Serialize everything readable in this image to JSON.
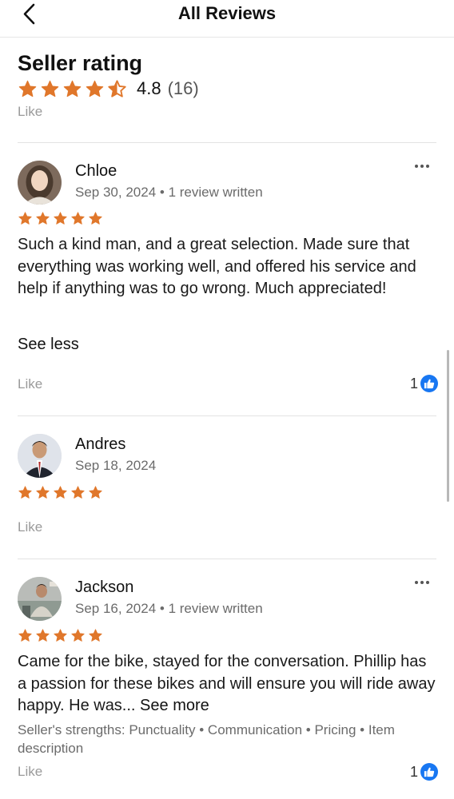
{
  "header": {
    "title": "All Reviews",
    "back_icon": "chevron-left-icon"
  },
  "summary": {
    "title": "Seller rating",
    "rating": 4.8,
    "rating_text": "4.8",
    "count_text": "(16)",
    "stars": 4.5,
    "like_label": "Like"
  },
  "colors": {
    "star": "#e0772b",
    "like_blue": "#1877f2",
    "muted": "#9a9a9a"
  },
  "reviews": [
    {
      "name": "Chloe",
      "date": "Sep 30, 2024",
      "meta_extra": "1 review written",
      "stars": 5,
      "text": "Such a kind man, and a great selection. Made sure that everything was working well, and offered his service and help if anything was to go wrong. Much appreciated!",
      "see_less": "See less",
      "like_label": "Like",
      "like_count": "1"
    },
    {
      "name": "Andres",
      "date": "Sep 18, 2024",
      "stars": 5,
      "like_label": "Like"
    },
    {
      "name": "Jackson",
      "date": "Sep 16, 2024",
      "meta_extra": "1 review written",
      "stars": 5,
      "text": "Came for the bike, stayed for the conversation. Phillip has a passion for these bikes and will ensure you will ride away happy. He was...",
      "see_more": "See more",
      "strengths_label": "Seller's strengths:",
      "strengths": [
        "Punctuality",
        "Communication",
        "Pricing",
        "Item description"
      ],
      "like_label": "Like",
      "like_count": "1"
    }
  ]
}
